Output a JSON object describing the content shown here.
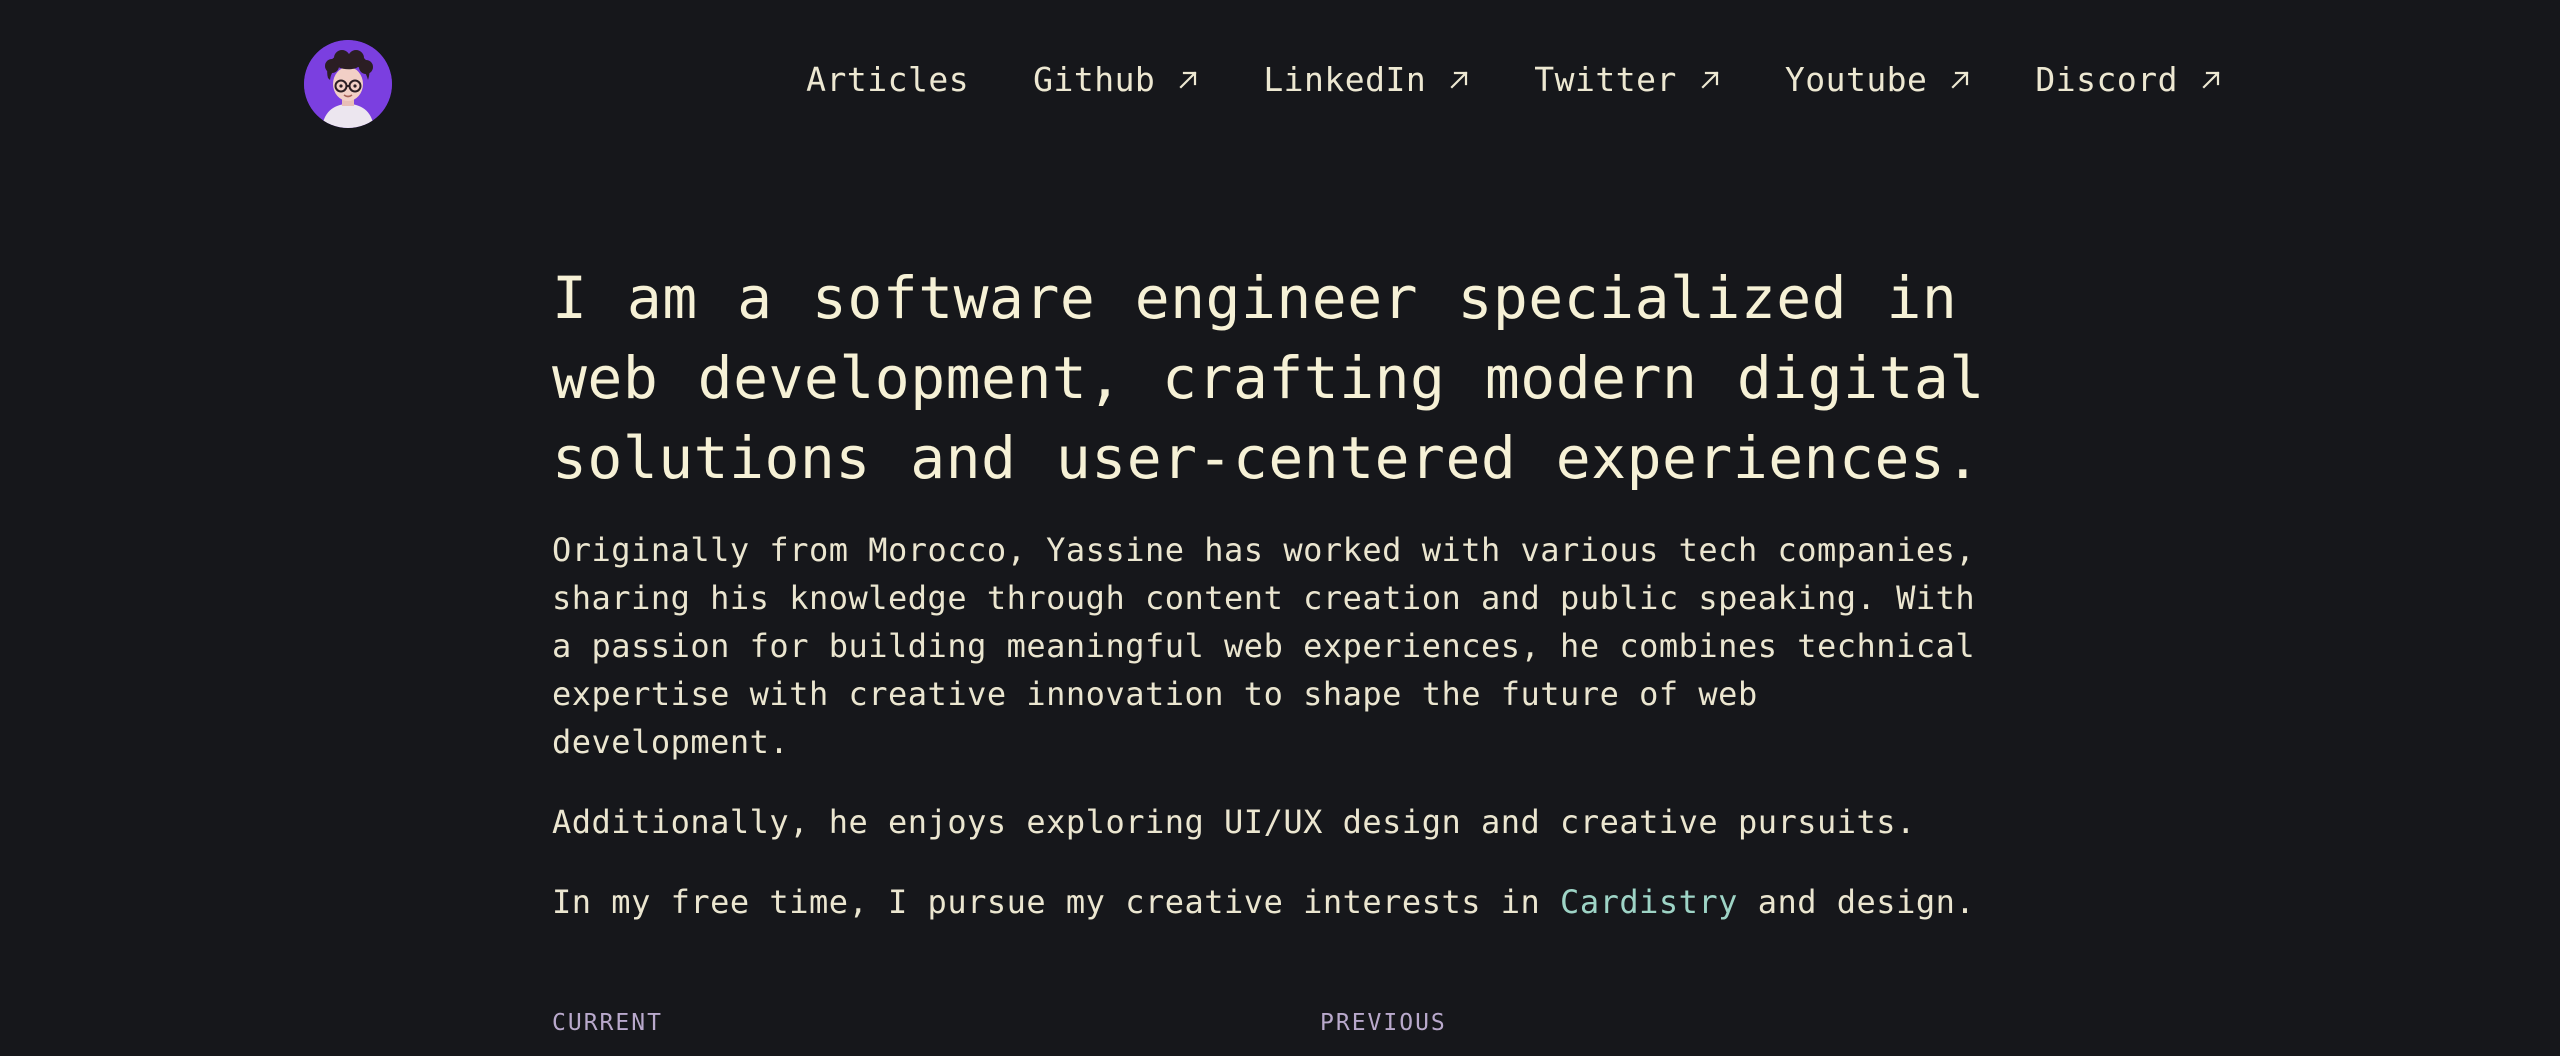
{
  "header": {
    "avatar_alt": "Yassine avatar",
    "nav": [
      {
        "label": "Articles",
        "external": false
      },
      {
        "label": "Github",
        "external": true
      },
      {
        "label": "LinkedIn",
        "external": true
      },
      {
        "label": "Twitter",
        "external": true
      },
      {
        "label": "Youtube",
        "external": true
      },
      {
        "label": "Discord",
        "external": true
      }
    ]
  },
  "main": {
    "headline": "I am a software engineer specialized in web development, crafting modern digital solutions and user-centered experiences.",
    "paragraph1": "Originally from Morocco, Yassine has worked with various tech companies, sharing his knowledge through content creation and public speaking. With a passion for building meaningful web experiences, he combines technical expertise with creative innovation to shape the future of web development.",
    "paragraph2": "Additionally, he enjoys exploring UI/UX design and creative pursuits.",
    "paragraph3_before": "In my free time, I pursue my creative interests in ",
    "paragraph3_link": "Cardistry",
    "paragraph3_after": " and design.",
    "section_current": "CURRENT",
    "section_previous": "PREVIOUS"
  },
  "colors": {
    "background": "#16171b",
    "text": "#f4f0dc",
    "link": "#9ed4c6",
    "avatar_bg": "#7b3fe0",
    "section_label": "#b9a9cc"
  }
}
